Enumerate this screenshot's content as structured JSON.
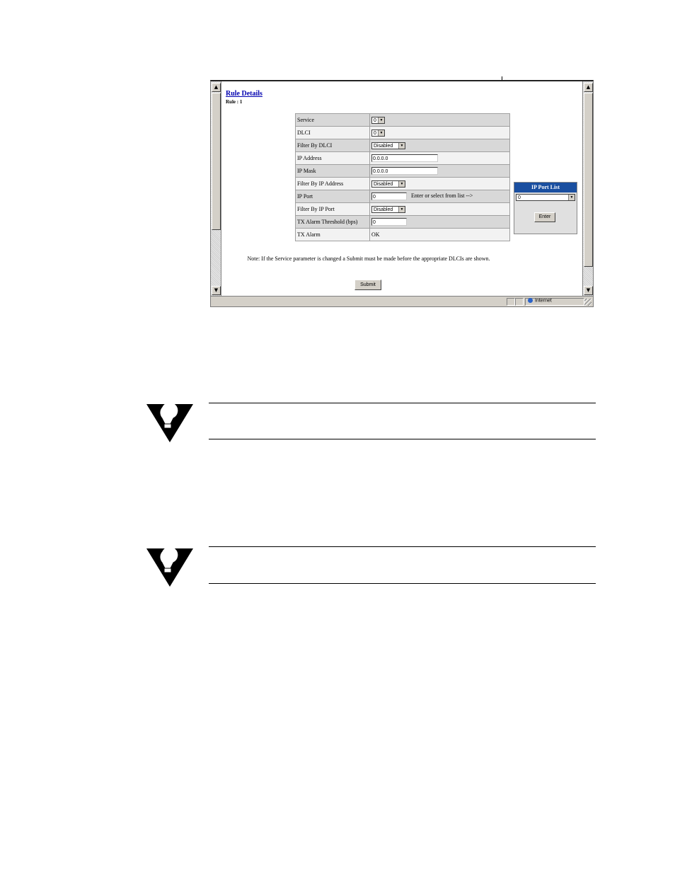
{
  "rule_details": {
    "title": "Rule Details",
    "subtitle": "Rule : 1"
  },
  "params": [
    {
      "label": "Service",
      "type": "select-small",
      "value": "0"
    },
    {
      "label": "DLCI",
      "type": "select-small",
      "value": "0"
    },
    {
      "label": "Filter By DLCI",
      "type": "select",
      "value": "Disabled"
    },
    {
      "label": "IP Address",
      "type": "input-ip",
      "value": "0.0.0.0"
    },
    {
      "label": "IP Mask",
      "type": "input-ip",
      "value": "0.0.0.0"
    },
    {
      "label": "Filter By IP Address",
      "type": "select",
      "value": "Disabled"
    },
    {
      "label": "IP Port",
      "type": "input-port",
      "value": "0",
      "hint": "Enter or select from list -->"
    },
    {
      "label": "Filter By IP Port",
      "type": "select",
      "value": "Disabled"
    },
    {
      "label": "TX Alarm Threshold (bps)",
      "type": "input-port",
      "value": "0"
    },
    {
      "label": "TX Alarm",
      "type": "text",
      "value": "OK"
    }
  ],
  "port_list": {
    "header": "IP Port List",
    "selected": "0",
    "enter_label": "Enter"
  },
  "note": "Note:  If the Service parameter is changed a Submit must be made before the appropriate DLCIs are shown.",
  "submit_label": "Submit",
  "status_bar": {
    "zone": "Internet"
  },
  "icons": {
    "scroll_up": "scroll-up-icon",
    "scroll_down": "scroll-down-icon",
    "tip": "lightbulb-tip-icon",
    "zone": "globe-icon"
  }
}
